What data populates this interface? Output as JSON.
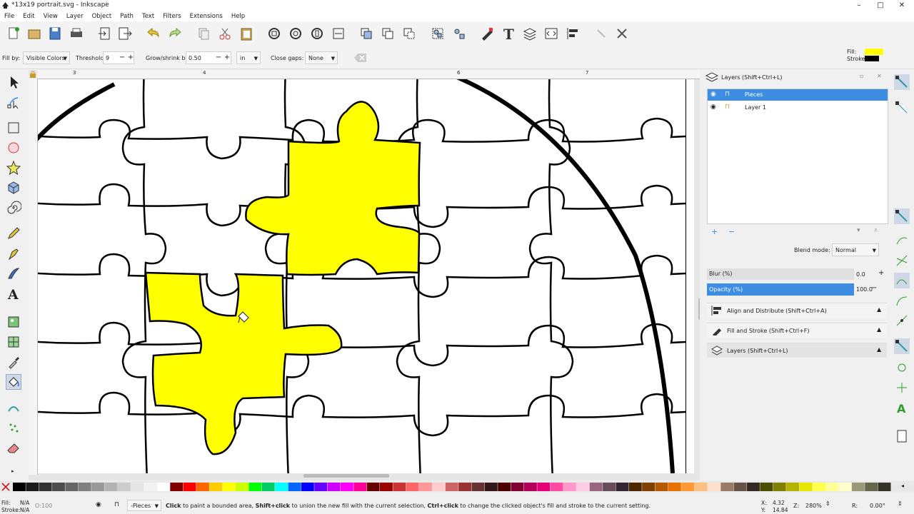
{
  "window": {
    "title": "*13x19 portrait.svg - Inkscape",
    "controls": [
      "–",
      "□",
      "✕"
    ]
  },
  "menu": [
    "File",
    "Edit",
    "View",
    "Layer",
    "Object",
    "Path",
    "Text",
    "Filters",
    "Extensions",
    "Help"
  ],
  "tool_options": {
    "fill_by_label": "Fill by:",
    "fill_by_value": "Visible Colors",
    "threshold_label": "Threshold:",
    "threshold_value": "9",
    "grow_label": "Grow/shrink by:",
    "grow_value": "0.50",
    "unit_value": "in",
    "close_gaps_label": "Close gaps:",
    "close_gaps_value": "None"
  },
  "fill_indicator": {
    "fill_label": "Fill:",
    "stroke_label": "Stroke:",
    "fill_color": "#ffff00",
    "stroke_color": "#000000"
  },
  "ruler_marks": [
    "3",
    "4",
    "6",
    "7"
  ],
  "layers_panel": {
    "header": "Layers (Shift+Ctrl+L)",
    "layers": [
      {
        "name": "Pieces",
        "selected": true
      },
      {
        "name": "Layer 1",
        "selected": false
      }
    ],
    "blend_mode_label": "Blend mode:",
    "blend_mode_value": "Normal",
    "blur_label": "Blur (%)",
    "blur_value": "0.0",
    "opacity_label": "Opacity (%)",
    "opacity_value": "100.0"
  },
  "docked_dialogs": [
    "Align and Distribute (Shift+Ctrl+A)",
    "Fill and Stroke (Shift+Ctrl+F)",
    "Layers (Shift+Ctrl+L)"
  ],
  "status": {
    "fill_label": "Fill:",
    "fill_value": "N/A",
    "stroke_label": "Stroke:",
    "stroke_value": "N/A",
    "opacity_value": "100",
    "layer_value": "-Pieces",
    "message_b1": "Click",
    "message_t1": " to paint a bounded area, ",
    "message_b2": "Shift+click",
    "message_t2": " to union the new fill with the current selection, ",
    "message_b3": "Ctrl+click",
    "message_t3": " to change the clicked object's fill and stroke to the current setting.",
    "x_label": "X:",
    "x_value": "4.32",
    "y_label": "Y:",
    "y_value": "14.84",
    "zoom_label": "Z:",
    "zoom_value": "280%",
    "rotation_label": "R:",
    "rotation_value": "0.00°"
  },
  "colors": {
    "accent": "#3d8ee3",
    "piece_fill": "#ffff00"
  }
}
